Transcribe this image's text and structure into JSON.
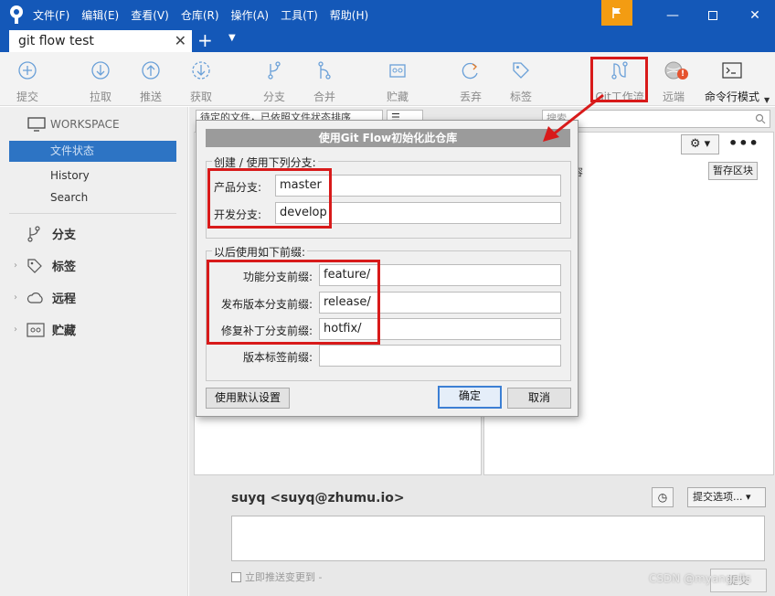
{
  "menu": [
    "文件(F)",
    "编辑(E)",
    "查看(V)",
    "仓库(R)",
    "操作(A)",
    "工具(T)",
    "帮助(H)"
  ],
  "tab": {
    "title": "git flow test",
    "close": "✕",
    "add": "+",
    "dropdown": "▼"
  },
  "toolbar": {
    "commit": "提交",
    "pull": "拉取",
    "push": "推送",
    "fetch": "获取",
    "branch": "分支",
    "merge": "合并",
    "stash": "贮藏",
    "discard": "丢弃",
    "tag": "标签",
    "gitflow": "Git工作流",
    "remote": "远端",
    "terminal": "命令行模式"
  },
  "sidebar": {
    "workspace": "WORKSPACE",
    "file_status": "文件状态",
    "history": "History",
    "search": "Search",
    "branches": "分支",
    "tags": "标签",
    "remotes": "远程",
    "stashes": "贮藏"
  },
  "main": {
    "filter": "待定的文件，已依照文件状态排序",
    "list_mode": "☰",
    "search_placeholder": "搜索",
    "header_frag": "容",
    "stage_button": "暂存区块",
    "author": "suyq <suyq@zhumu.io>",
    "commit_options": "提交选项...",
    "push_immediately": "立即推送变更到 -",
    "commit_button": "提交"
  },
  "dialog": {
    "title": "使用Git Flow初始化此仓库",
    "group1_title": "创建 / 使用下列分支:",
    "production_label": "产品分支:",
    "production_value": "master",
    "develop_label": "开发分支:",
    "develop_value": "develop",
    "group2_title": "以后使用如下前缀:",
    "feature_label": "功能分支前缀:",
    "feature_value": "feature/",
    "release_label": "发布版本分支前缀:",
    "release_value": "release/",
    "hotfix_label": "修复补丁分支前缀:",
    "hotfix_value": "hotfix/",
    "version_tag_label": "版本标签前缀:",
    "version_tag_value": "",
    "defaults_button": "使用默认设置",
    "ok_button": "确定",
    "cancel_button": "取消"
  },
  "watermark": "CSDN @myangells",
  "colors": {
    "titlebar": "#1458b8",
    "accent_selected": "#2d74c4",
    "annotation_red": "#d81a1a",
    "flag": "#f39c12"
  }
}
